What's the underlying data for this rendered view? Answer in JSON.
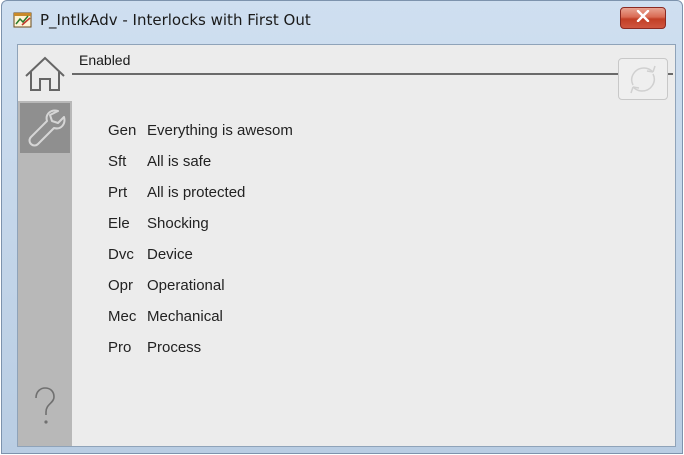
{
  "window": {
    "title": "P_IntlkAdv - Interlocks with First Out"
  },
  "icons": {
    "app": "faceplate-app-icon",
    "close": "close-x-icon",
    "home": "home-icon",
    "maintenance": "wrench-icon",
    "help": "question-mark-icon",
    "refresh": "refresh-icon"
  },
  "status": {
    "text": "Enabled"
  },
  "interlocks": [
    {
      "code": "Gen",
      "description": "Everything is awesom"
    },
    {
      "code": "Sft",
      "description": "All is safe"
    },
    {
      "code": "Prt",
      "description": "All is protected"
    },
    {
      "code": "Ele",
      "description": "Shocking"
    },
    {
      "code": "Dvc",
      "description": "Device"
    },
    {
      "code": "Opr",
      "description": "Operational"
    },
    {
      "code": "Mec",
      "description": "Mechanical"
    },
    {
      "code": "Pro",
      "description": "Process"
    }
  ],
  "colors": {
    "titlebar": "#c4d6ea",
    "close_button": "#c94a31",
    "client_background": "#ececec",
    "nav_bar": "#b8b8b8",
    "nav_selected": "#8f8f8f"
  }
}
